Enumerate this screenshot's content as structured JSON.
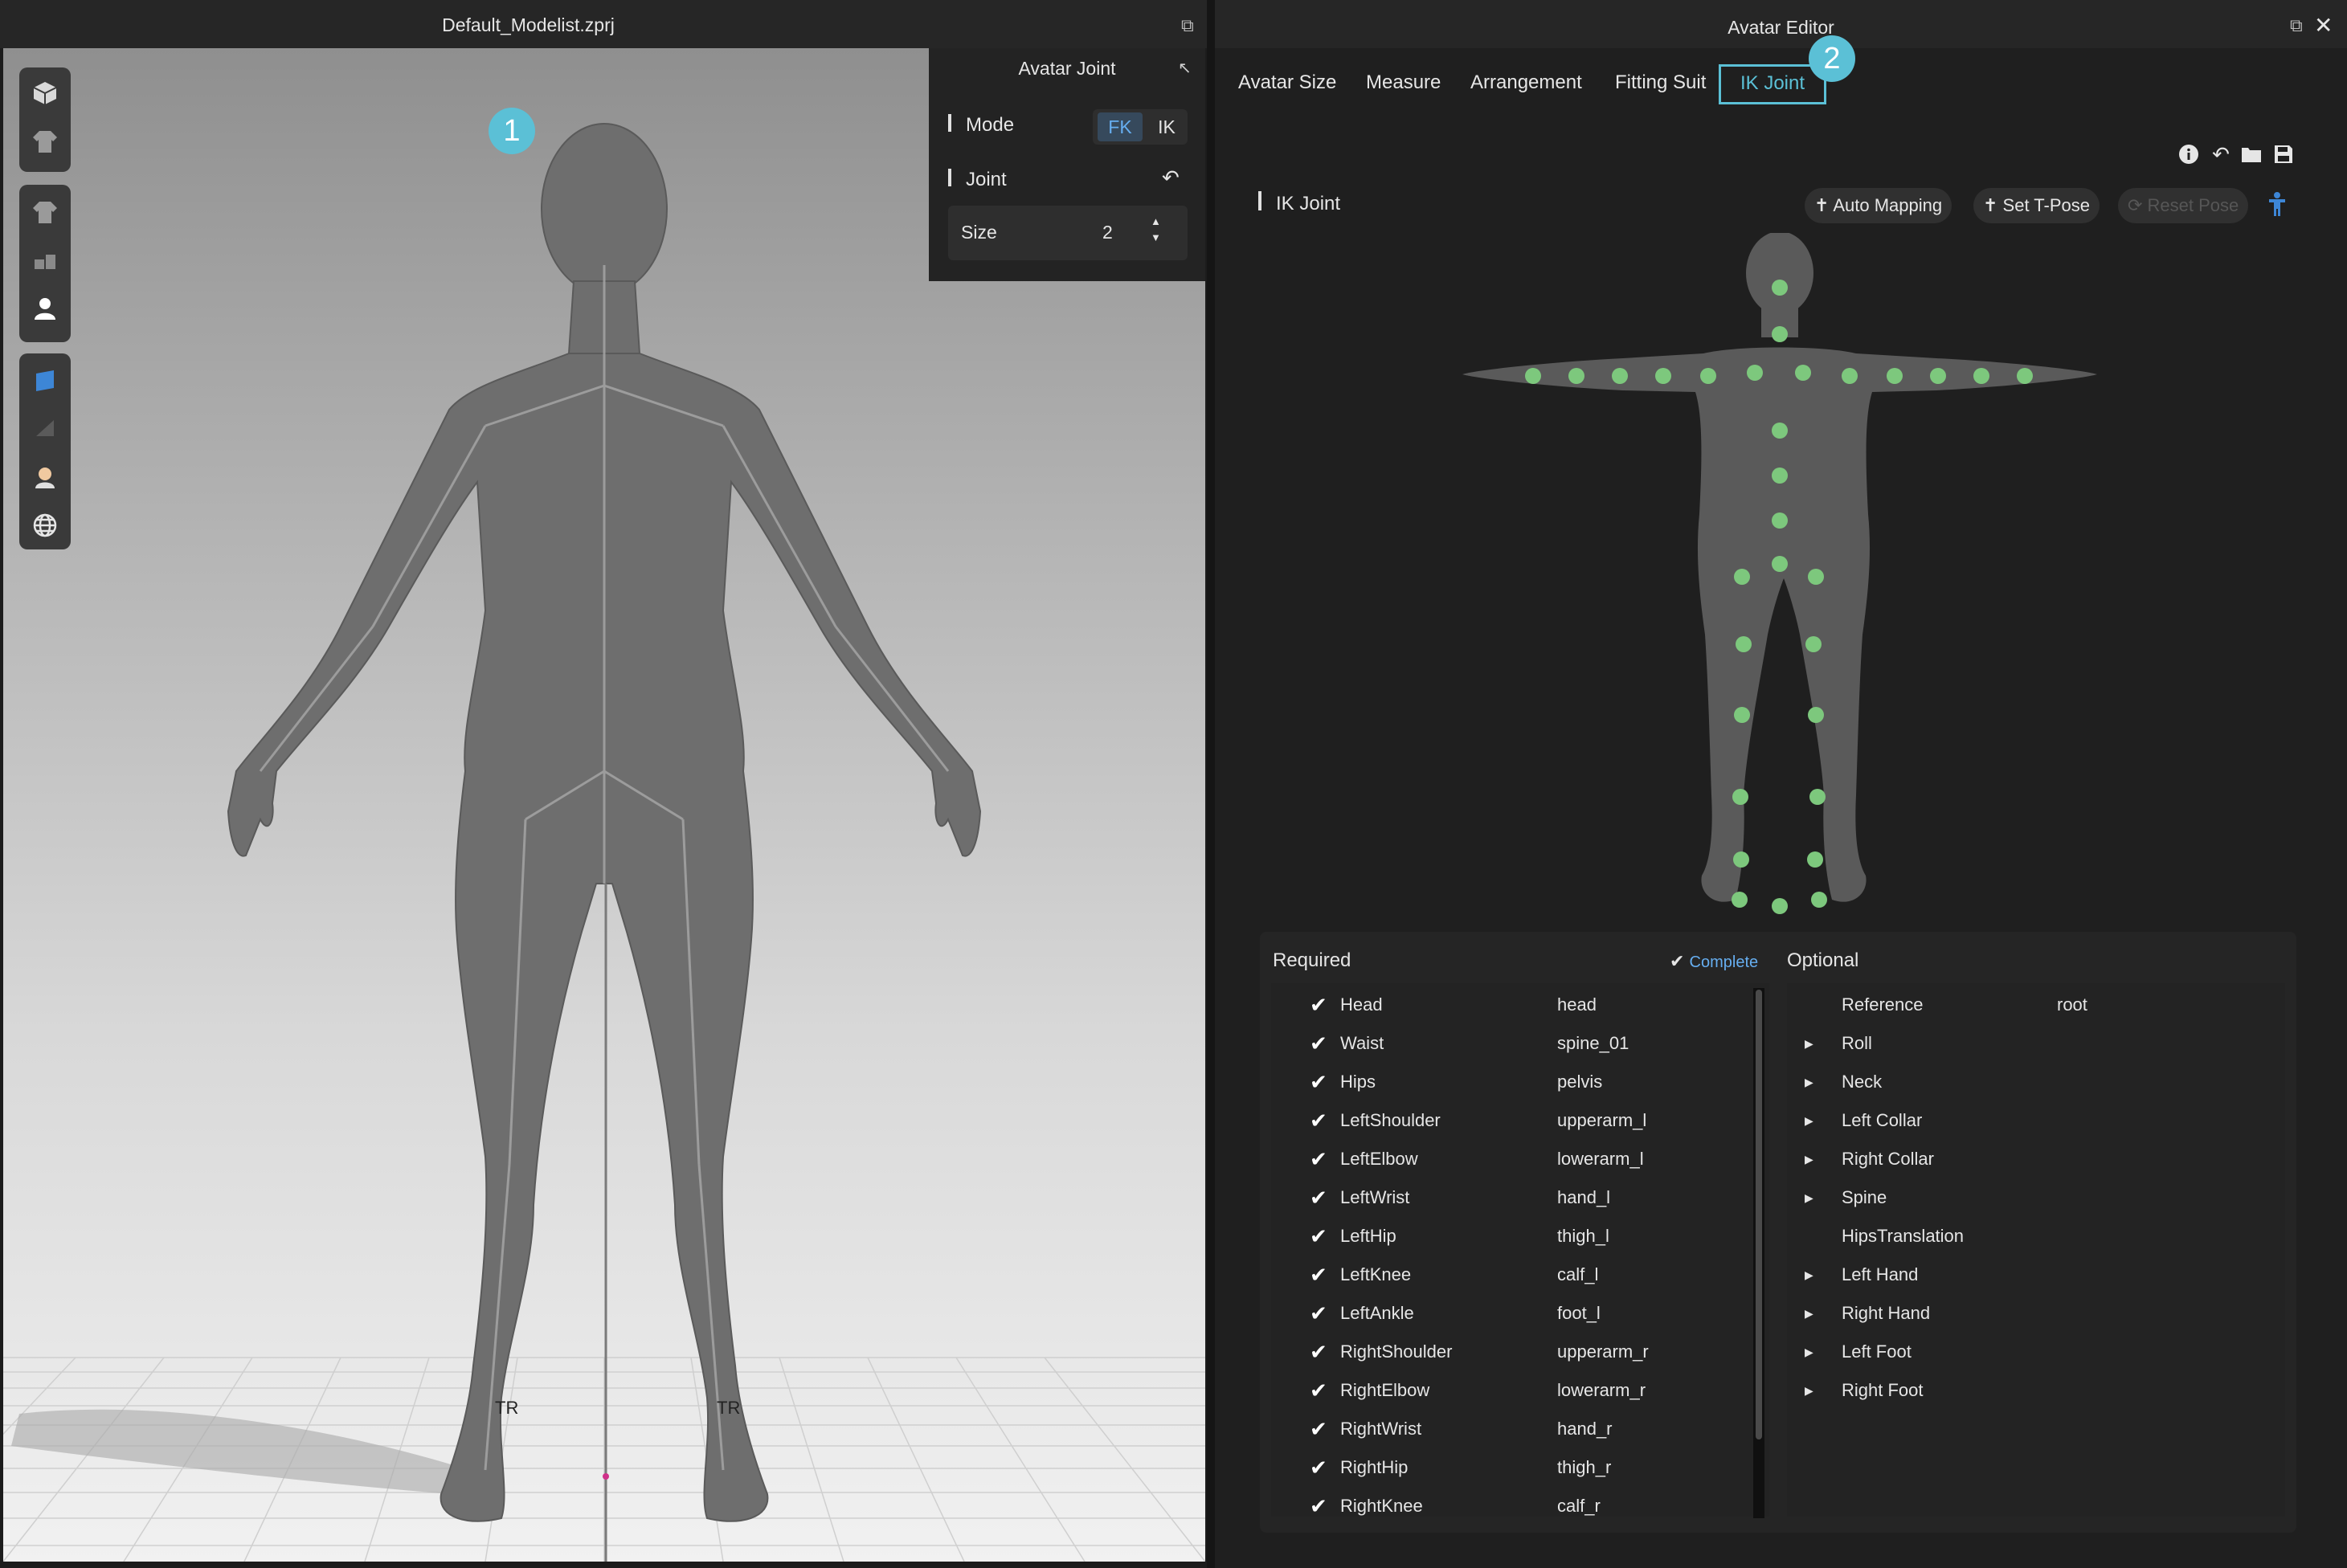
{
  "left_window": {
    "title": "Default_Modelist.zprj",
    "viewport_labels": {
      "left_foot_marker": "TR",
      "right_foot_marker": "TR"
    },
    "badge": "1"
  },
  "avatar_joint_panel": {
    "title": "Avatar Joint",
    "mode_label": "Mode",
    "mode_options": [
      "FK",
      "IK"
    ],
    "mode_selected": "FK",
    "joint_label": "Joint",
    "size_label": "Size",
    "size_value": "2"
  },
  "right_window": {
    "title": "Avatar Editor",
    "tabs": [
      "Avatar Size",
      "Measure",
      "Arrangement",
      "Fitting Suit",
      "IK Joint"
    ],
    "active_tab": "IK Joint",
    "badge": "2"
  },
  "ik_joint": {
    "section_label": "IK Joint",
    "buttons": {
      "auto_mapping": "Auto Mapping",
      "set_tpose": "Set T-Pose",
      "reset_pose": "Reset Pose"
    }
  },
  "required": {
    "title": "Required",
    "status": "Complete",
    "rows": [
      {
        "name": "Head",
        "bone": "head"
      },
      {
        "name": "Waist",
        "bone": "spine_01"
      },
      {
        "name": "Hips",
        "bone": "pelvis"
      },
      {
        "name": "LeftShoulder",
        "bone": "upperarm_l"
      },
      {
        "name": "LeftElbow",
        "bone": "lowerarm_l"
      },
      {
        "name": "LeftWrist",
        "bone": "hand_l"
      },
      {
        "name": "LeftHip",
        "bone": "thigh_l"
      },
      {
        "name": "LeftKnee",
        "bone": "calf_l"
      },
      {
        "name": "LeftAnkle",
        "bone": "foot_l"
      },
      {
        "name": "RightShoulder",
        "bone": "upperarm_r"
      },
      {
        "name": "RightElbow",
        "bone": "lowerarm_r"
      },
      {
        "name": "RightWrist",
        "bone": "hand_r"
      },
      {
        "name": "RightHip",
        "bone": "thigh_r"
      },
      {
        "name": "RightKnee",
        "bone": "calf_r"
      }
    ]
  },
  "optional": {
    "title": "Optional",
    "rows": [
      {
        "name": "Reference",
        "value": "root",
        "expandable": false
      },
      {
        "name": "Roll",
        "value": "",
        "expandable": true
      },
      {
        "name": "Neck",
        "value": "",
        "expandable": true
      },
      {
        "name": "Left Collar",
        "value": "",
        "expandable": true
      },
      {
        "name": "Right Collar",
        "value": "",
        "expandable": true
      },
      {
        "name": "Spine",
        "value": "",
        "expandable": true
      },
      {
        "name": "HipsTranslation",
        "value": "",
        "expandable": false
      },
      {
        "name": "Left Hand",
        "value": "",
        "expandable": true
      },
      {
        "name": "Right Hand",
        "value": "",
        "expandable": true
      },
      {
        "name": "Left Foot",
        "value": "",
        "expandable": true
      },
      {
        "name": "Right Foot",
        "value": "",
        "expandable": true
      }
    ]
  },
  "colors": {
    "accent": "#5bc0d6",
    "selected_blue": "#66aef0",
    "joint_dot": "#7dc87d",
    "panel_bg": "#1f1f1f"
  }
}
